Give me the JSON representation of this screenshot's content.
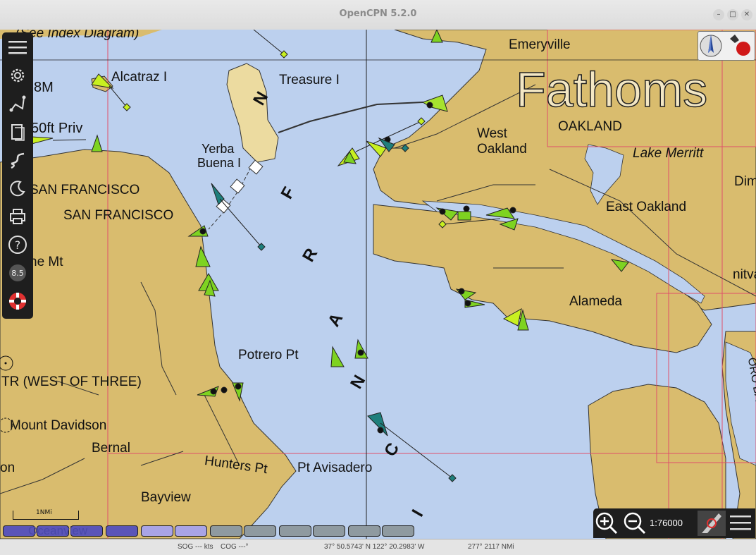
{
  "window": {
    "title": "OpenCPN 5.2.0"
  },
  "toolbar": {
    "items": [
      {
        "name": "menu",
        "icon": "hamburger-icon"
      },
      {
        "name": "settings",
        "icon": "gear-icon"
      },
      {
        "name": "route-manager",
        "icon": "route-icon"
      },
      {
        "name": "tracks",
        "icon": "document-icon"
      },
      {
        "name": "track",
        "icon": "track-icon"
      },
      {
        "name": "color-scheme",
        "icon": "moon-icon"
      },
      {
        "name": "print",
        "icon": "printer-icon"
      },
      {
        "name": "help",
        "icon": "question-icon"
      },
      {
        "name": "tide-current",
        "icon": "tide-icon",
        "label": "8.5"
      },
      {
        "name": "mob",
        "icon": "lifebuoy-icon"
      }
    ]
  },
  "chart": {
    "depth_units_watermark": "Fathoms",
    "labels": {
      "index_diagram": "(See Index Diagram)",
      "alcatraz": "Alcatraz I",
      "depth_8m": "8M",
      "priv": "50ft Priv",
      "treasure": "Treasure I",
      "yerba": "Yerba",
      "buena": "Buena I",
      "emeryville": "Emeryville",
      "oakland": "OAKLAND",
      "west": "West",
      "west_oakland": "Oakland",
      "lake_merritt": "Lake Merritt",
      "dim": "Dim",
      "east_oakland": "East Oakland",
      "sf_caps": "SAN FRANCISCO",
      "sf": "SAN FRANCISCO",
      "alameda": "Alameda",
      "nitval": "nitval",
      "potrero": "Potrero Pt",
      "tr": "TR (WEST OF THREE)",
      "mount_davidson": "Mount Davidson",
      "bernal": "Bernal",
      "hunters": "Hunters Pt",
      "avisadero": "Pt Avisadero",
      "bayview": "Bayview",
      "on": "on",
      "ne_mt": "ne Mt",
      "oro_ba": "ORO BA",
      "bay_letters": [
        "N",
        "F",
        "R",
        "A",
        "N",
        "C",
        "I"
      ]
    },
    "scale_bar": "1NMi"
  },
  "compass_widget": {
    "icon": "compass-icon",
    "gps_icon": "gps-status-icon"
  },
  "zoom_controls": {
    "zoom_in_icon": "zoom-in-icon",
    "zoom_out_icon": "zoom-out-icon",
    "scale": "1:76000",
    "ais_icon": "ais-icon",
    "menu_icon": "hamburger-icon"
  },
  "piano": {
    "keys": [
      {
        "label": "Oceanview",
        "color": "#5a55b8"
      },
      {
        "label": "",
        "color": "#5a55b8"
      },
      {
        "label": "",
        "color": "#5a55b8"
      },
      {
        "label": "",
        "color": "#5a55b8"
      },
      {
        "label": "",
        "color": "#a9a4e6"
      },
      {
        "label": "",
        "color": "#a9a4e6"
      },
      {
        "label": "",
        "color": "#8f9aa0"
      },
      {
        "label": "",
        "color": "#8f9aa0"
      },
      {
        "label": "",
        "color": "#8f9aa0"
      },
      {
        "label": "",
        "color": "#8f9aa0"
      },
      {
        "label": "",
        "color": "#8f9aa0"
      },
      {
        "label": "",
        "color": "#8f9aa0"
      }
    ]
  },
  "status": {
    "sog": "SOG --- kts",
    "cog": "COG ---°",
    "position": "37° 50.5743' N  122° 20.2983' W",
    "bearing": "277°  2117 NMi"
  },
  "colors": {
    "water": "#bcd0ee",
    "land": "#d9bc6e",
    "ais_target": "#7ed321",
    "ais_target_dark": "#1e7f7c"
  }
}
